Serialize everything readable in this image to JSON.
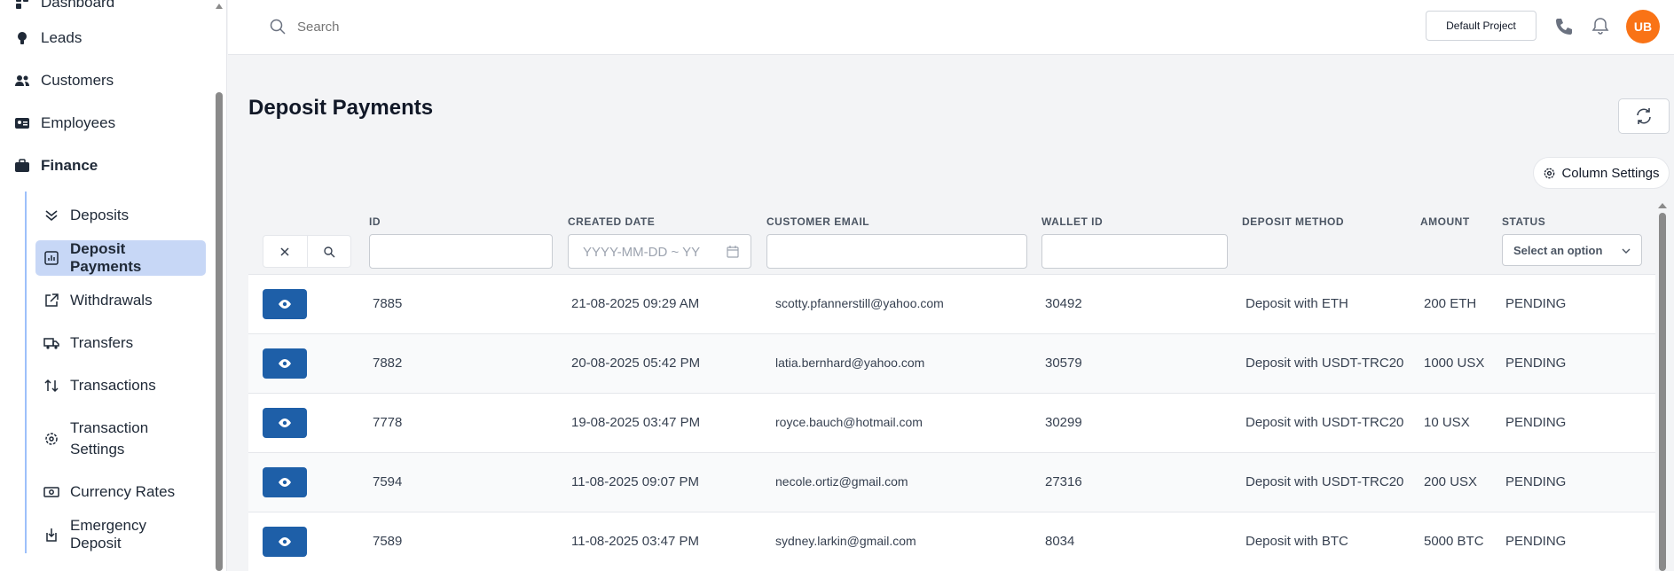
{
  "sidebar": {
    "items": [
      {
        "label": "Dashboard",
        "icon": "dashboard-icon"
      },
      {
        "label": "Leads",
        "icon": "lightbulb-icon"
      },
      {
        "label": "Customers",
        "icon": "users-icon"
      },
      {
        "label": "Employees",
        "icon": "id-card-icon"
      },
      {
        "label": "Finance",
        "icon": "briefcase-icon"
      }
    ],
    "finance_items": [
      {
        "label": "Deposits",
        "icon": "double-chevron-down-icon"
      },
      {
        "label": "Deposit Payments",
        "icon": "bar-chart-icon",
        "active": true
      },
      {
        "label": "Withdrawals",
        "icon": "external-link-icon"
      },
      {
        "label": "Transfers",
        "icon": "truck-icon"
      },
      {
        "label": "Transactions",
        "icon": "arrows-up-down-icon"
      },
      {
        "label": "Transaction Settings",
        "icon": "settings-icon"
      },
      {
        "label": "Currency Rates",
        "icon": "banknote-icon"
      },
      {
        "label": "Emergency Deposit",
        "icon": "deposit-icon"
      }
    ]
  },
  "header": {
    "search_placeholder": "Search",
    "project_label": "Default Project",
    "avatar_initials": "UB"
  },
  "main": {
    "title": "Deposit Payments",
    "column_settings_label": "Column Settings"
  },
  "table": {
    "columns": [
      "ID",
      "CREATED DATE",
      "CUSTOMER EMAIL",
      "WALLET ID",
      "DEPOSIT METHOD",
      "AMOUNT",
      "STATUS"
    ],
    "date_placeholder": "YYYY-MM-DD ~ YY",
    "status_select_placeholder": "Select an option",
    "rows": [
      {
        "id": "7885",
        "created": "21-08-2025 09:29 AM",
        "email": "scotty.pfannerstill@yahoo.com",
        "wallet": "30492",
        "method": "Deposit with ETH",
        "amount": "200 ETH",
        "status": "PENDING"
      },
      {
        "id": "7882",
        "created": "20-08-2025 05:42 PM",
        "email": "latia.bernhard@yahoo.com",
        "wallet": "30579",
        "method": "Deposit with USDT-TRC20",
        "amount": "1000 USX",
        "status": "PENDING"
      },
      {
        "id": "7778",
        "created": "19-08-2025 03:47 PM",
        "email": "royce.bauch@hotmail.com",
        "wallet": "30299",
        "method": "Deposit with USDT-TRC20",
        "amount": "10 USX",
        "status": "PENDING"
      },
      {
        "id": "7594",
        "created": "11-08-2025 09:07 PM",
        "email": "necole.ortiz@gmail.com",
        "wallet": "27316",
        "method": "Deposit with USDT-TRC20",
        "amount": "200 USX",
        "status": "PENDING"
      },
      {
        "id": "7589",
        "created": "11-08-2025 03:47 PM",
        "email": "sydney.larkin@gmail.com",
        "wallet": "8034",
        "method": "Deposit with BTC",
        "amount": "5000 BTC",
        "status": "PENDING"
      }
    ]
  },
  "colors": {
    "accent": "#1e5fa8",
    "avatar": "#f97316",
    "active_nav": "#c7d7f6"
  }
}
